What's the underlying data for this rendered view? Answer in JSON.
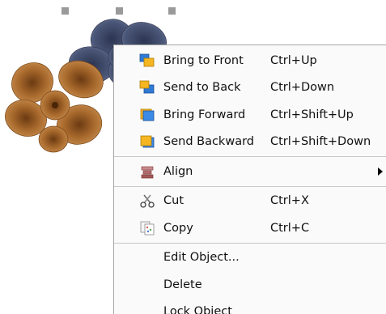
{
  "menu": {
    "groups": [
      [
        {
          "icon": "bring-to-front-icon",
          "label": "Bring to Front",
          "shortcut": "Ctrl+Up"
        },
        {
          "icon": "send-to-back-icon",
          "label": "Send to Back",
          "shortcut": "Ctrl+Down"
        },
        {
          "icon": "bring-forward-icon",
          "label": "Bring Forward",
          "shortcut": "Ctrl+Shift+Up"
        },
        {
          "icon": "send-backward-icon",
          "label": "Send Backward",
          "shortcut": "Ctrl+Shift+Down"
        }
      ],
      [
        {
          "icon": "align-icon",
          "label": "Align",
          "shortcut": "",
          "submenu": true
        }
      ],
      [
        {
          "icon": "cut-icon",
          "label": "Cut",
          "shortcut": "Ctrl+X"
        },
        {
          "icon": "copy-icon",
          "label": "Copy",
          "shortcut": "Ctrl+C"
        }
      ],
      [
        {
          "icon": "",
          "label": "Edit Object...",
          "shortcut": ""
        },
        {
          "icon": "",
          "label": "Delete",
          "shortcut": ""
        },
        {
          "icon": "",
          "label": "Lock Object",
          "shortcut": ""
        }
      ]
    ]
  },
  "colors": {
    "brown_flower": "#a8692c",
    "navy_flower": "#3f4a68",
    "handle": "#9a9a9a",
    "menu_bg": "#fafafa"
  }
}
